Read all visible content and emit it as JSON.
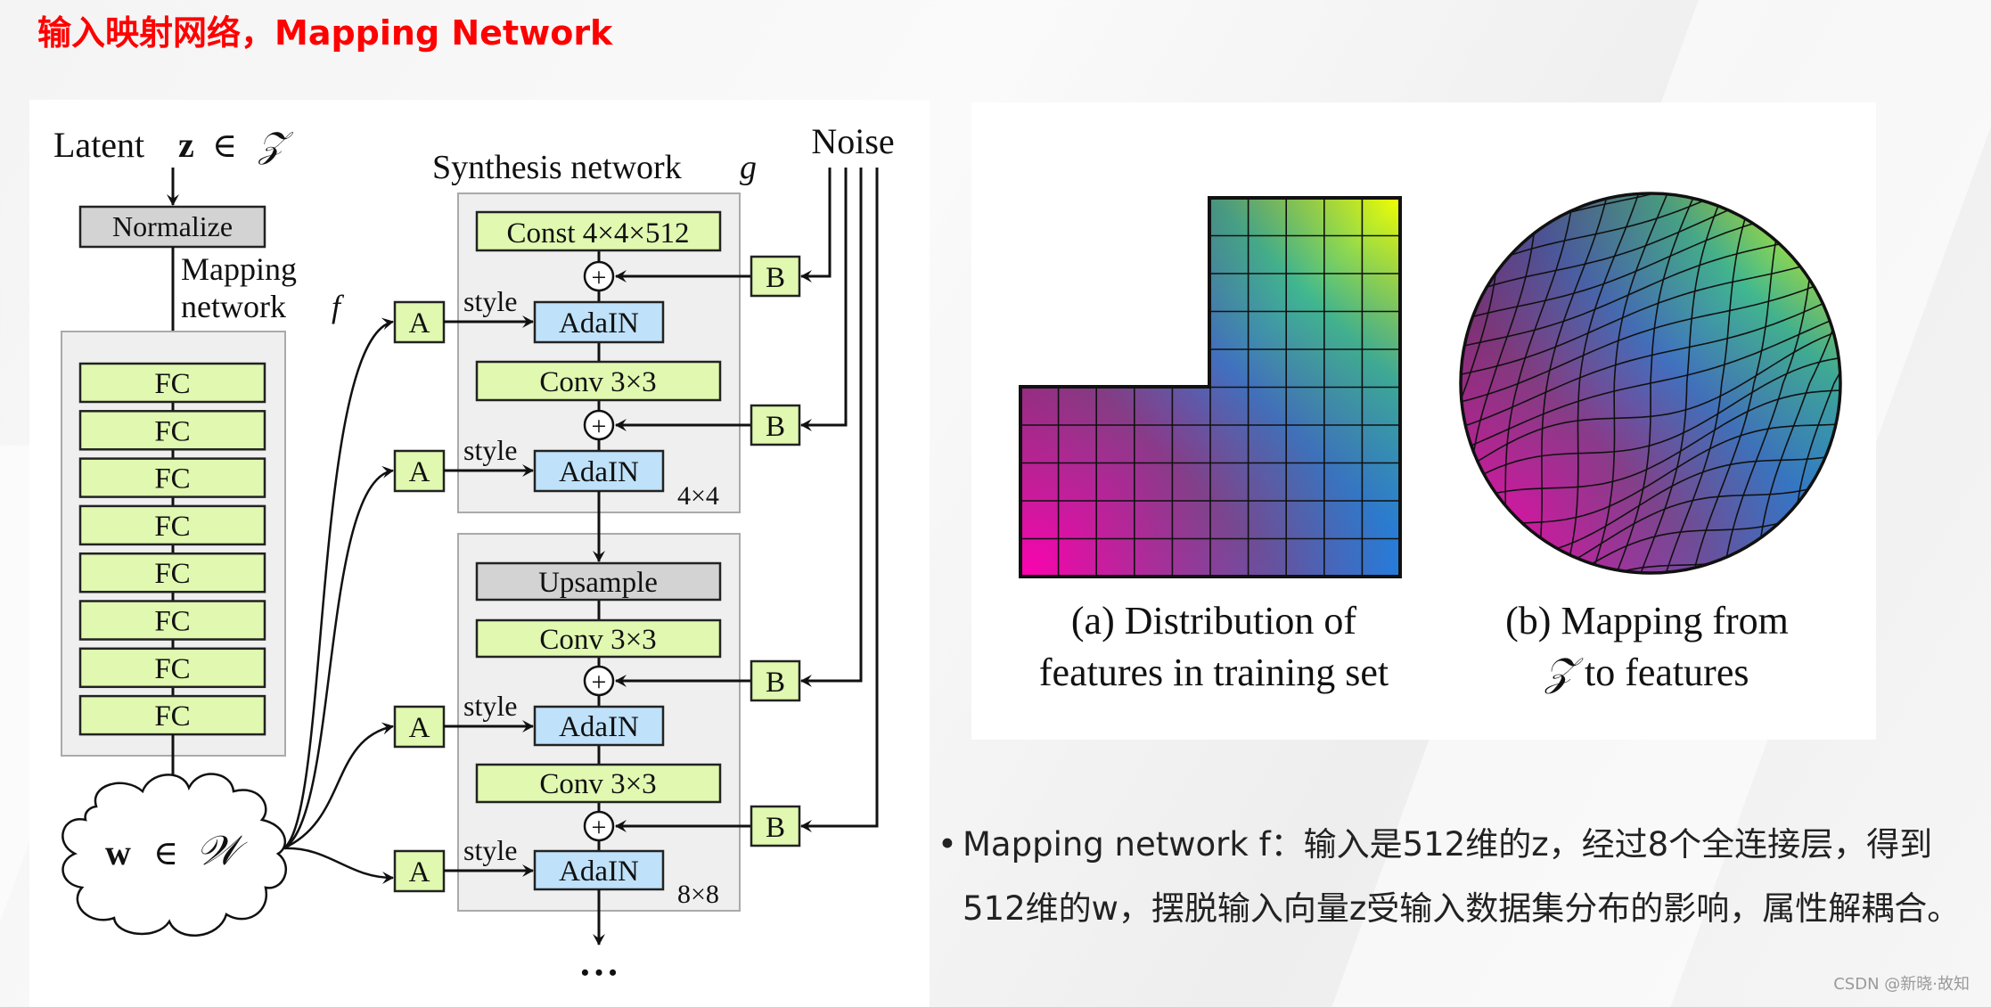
{
  "slide": {
    "title": "输入映射网络，Mapping Network",
    "watermark": "CSDN @新晓·故知"
  },
  "diagram": {
    "latent_label": "Latent",
    "latent_var": "z",
    "latent_in": "∈",
    "latent_space": "𝒵",
    "normalize": "Normalize",
    "mapping_label_1": "Mapping",
    "mapping_label_2": "network",
    "mapping_symbol": "f",
    "fc_layers": [
      "FC",
      "FC",
      "FC",
      "FC",
      "FC",
      "FC",
      "FC",
      "FC"
    ],
    "w_var": "w",
    "w_in": "∈",
    "w_space": "𝒲",
    "synthesis_label": "Synthesis network",
    "synthesis_symbol": "g",
    "noise_label": "Noise",
    "const_block": "Const 4×4×512",
    "adain": "AdaIN",
    "conv": "Conv 3×3",
    "upsample": "Upsample",
    "style": "style",
    "a_label": "A",
    "b_label": "B",
    "plus": "+",
    "res1": "4×4",
    "res2": "8×8",
    "continuation": "• • •"
  },
  "figure": {
    "caption_a_1": "(a) Distribution of",
    "caption_a_2": "features in training set",
    "caption_b_1": "(b) Mapping from",
    "caption_b_2_symbol": "𝒵",
    "caption_b_2": " to features"
  },
  "bullet": {
    "marker": "•",
    "line1": "Mapping network f：输入是512维的z，经过8个全连接层，得到",
    "line2": "512维的w，摆脱输入向量z受输入数据集分布的影响，属性解耦合。"
  },
  "colors": {
    "title": "#ff0000",
    "green_box": "#e0f8b0",
    "blue_box": "#bfe1fa",
    "gray_box": "#d3d3d3",
    "container": "#efefef"
  }
}
